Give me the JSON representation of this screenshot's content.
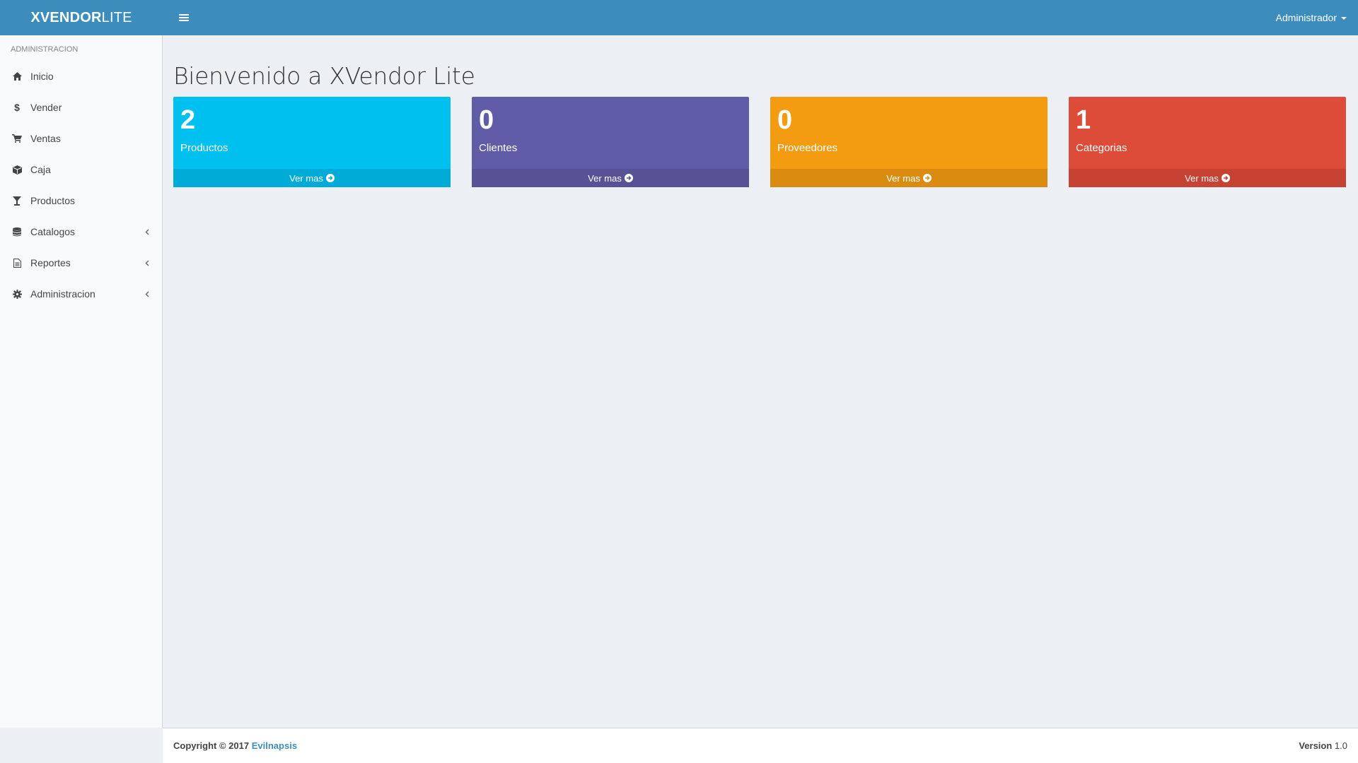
{
  "header": {
    "logo_bold": "XVENDOR",
    "logo_light": "LITE",
    "user_label": "Administrador"
  },
  "sidebar": {
    "section_title": "ADMINISTRACION",
    "items": [
      {
        "label": "Inicio",
        "icon": "home-icon",
        "submenu": false
      },
      {
        "label": "Vender",
        "icon": "dollar-icon",
        "submenu": false
      },
      {
        "label": "Ventas",
        "icon": "cart-icon",
        "submenu": false
      },
      {
        "label": "Caja",
        "icon": "cube-icon",
        "submenu": false
      },
      {
        "label": "Productos",
        "icon": "glass-icon",
        "submenu": false
      },
      {
        "label": "Catalogos",
        "icon": "database-icon",
        "submenu": true
      },
      {
        "label": "Reportes",
        "icon": "file-icon",
        "submenu": true
      },
      {
        "label": "Administracion",
        "icon": "gear-icon",
        "submenu": true
      }
    ]
  },
  "main": {
    "title": "Bienvenido a XVendor Lite",
    "boxes": [
      {
        "count": "2",
        "label": "Productos",
        "footer": "Ver mas",
        "color": "#00c0ef",
        "footer_color": "#00acd7"
      },
      {
        "count": "0",
        "label": "Clientes",
        "footer": "Ver mas",
        "color": "#605ca8",
        "footer_color": "#565295"
      },
      {
        "count": "0",
        "label": "Proveedores",
        "footer": "Ver mas",
        "color": "#f39c12",
        "footer_color": "#da8c10"
      },
      {
        "count": "1",
        "label": "Categorias",
        "footer": "Ver mas",
        "color": "#dd4b39",
        "footer_color": "#c64333"
      }
    ]
  },
  "footer": {
    "copyright": "Copyright © 2017",
    "company": "Evilnapsis",
    "version_label": "Version",
    "version_value": "1.0"
  }
}
